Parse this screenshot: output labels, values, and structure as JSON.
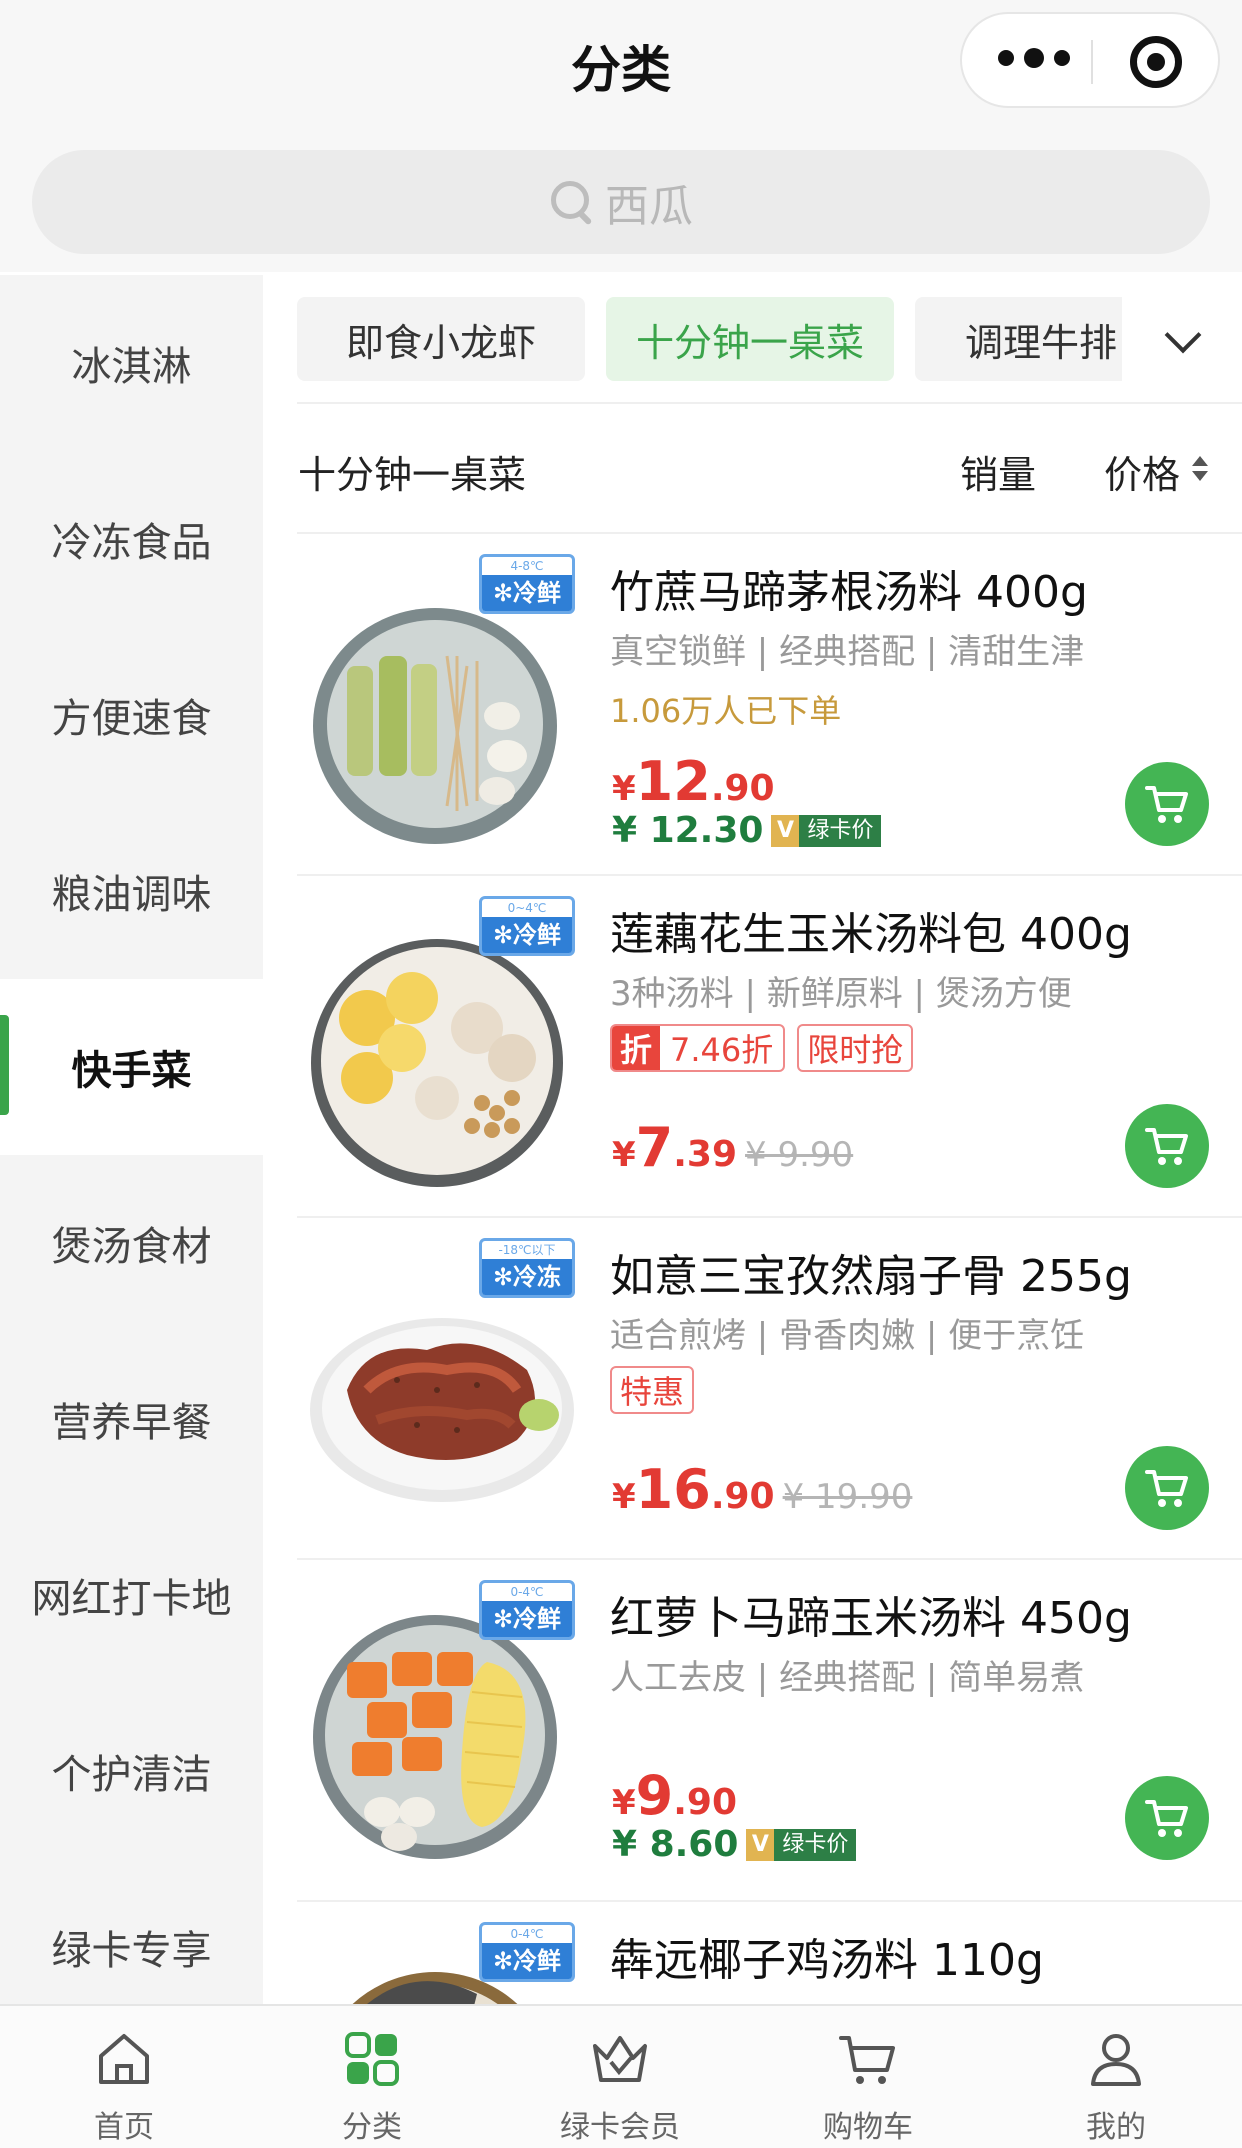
{
  "header": {
    "title": "分类"
  },
  "search": {
    "placeholder": "西瓜"
  },
  "sidebar": {
    "items": [
      {
        "label": "冰淇淋",
        "active": false
      },
      {
        "label": "冷冻食品",
        "active": false
      },
      {
        "label": "方便速食",
        "active": false
      },
      {
        "label": "粮油调味",
        "active": false
      },
      {
        "label": "快手菜",
        "active": true
      },
      {
        "label": "煲汤食材",
        "active": false
      },
      {
        "label": "营养早餐",
        "active": false
      },
      {
        "label": "网红打卡地",
        "active": false
      },
      {
        "label": "个护清洁",
        "active": false
      },
      {
        "label": "绿卡专享",
        "active": false
      }
    ]
  },
  "tabs": [
    {
      "label": "即食小龙虾",
      "active": false
    },
    {
      "label": "十分钟一桌菜",
      "active": true
    },
    {
      "label": "调理牛排",
      "active": false
    }
  ],
  "sort": {
    "title": "十分钟一桌菜",
    "sales": "销量",
    "price": "价格"
  },
  "products": [
    {
      "name": "竹蔗马蹄茅根汤料 400g",
      "tags": "真空锁鲜 | 经典搭配 | 清甜生津",
      "sold": "1.06万人已下单",
      "badge_temp": "4-8℃",
      "badge_kind": "✻冷鲜",
      "currency": "¥",
      "price_int": "12",
      "price_dec": ".90",
      "member_price": "¥ 12.30",
      "member_v": "V",
      "member_label": "绿卡价"
    },
    {
      "name": "莲藕花生玉米汤料包 400g",
      "tags": "3种汤料 | 新鲜原料 | 煲汤方便",
      "promo_zhe": "折",
      "promo_rate": "7.46折",
      "promo_tag": "限时抢",
      "badge_temp": "0~4℃",
      "badge_kind": "✻冷鲜",
      "currency": "¥",
      "price_int": "7",
      "price_dec": ".39",
      "price_old": "¥ 9.90"
    },
    {
      "name": "如意三宝孜然扇子骨 255g",
      "tags": "适合煎烤 | 骨香肉嫩 | 便于烹饪",
      "promo_tag": "特惠",
      "badge_temp": "-18℃以下",
      "badge_kind": "✻冷冻",
      "currency": "¥",
      "price_int": "16",
      "price_dec": ".90",
      "price_old": "¥ 19.90"
    },
    {
      "name": "红萝卜马蹄玉米汤料 450g",
      "tags": "人工去皮 | 经典搭配 | 简单易煮",
      "badge_temp": "0-4℃",
      "badge_kind": "✻冷鲜",
      "currency": "¥",
      "price_int": "9",
      "price_dec": ".90",
      "member_price": "¥ 8.60",
      "member_v": "V",
      "member_label": "绿卡价"
    },
    {
      "name": "犇远椰子鸡汤料 110g",
      "badge_temp": "0-4℃",
      "badge_kind": "✻冷鲜"
    }
  ],
  "bottom_nav": [
    {
      "label": "首页",
      "icon": "home-icon",
      "active": false
    },
    {
      "label": "分类",
      "icon": "category-grid-icon",
      "active": true
    },
    {
      "label": "绿卡会员",
      "icon": "crown-icon",
      "active": false
    },
    {
      "label": "购物车",
      "icon": "cart-icon",
      "active": false
    },
    {
      "label": "我的",
      "icon": "user-icon",
      "active": false
    }
  ],
  "colors": {
    "accent_green": "#3aa44a",
    "price_red": "#e23a33",
    "member_green": "#1f7d3e",
    "cart_green": "#44b554"
  }
}
